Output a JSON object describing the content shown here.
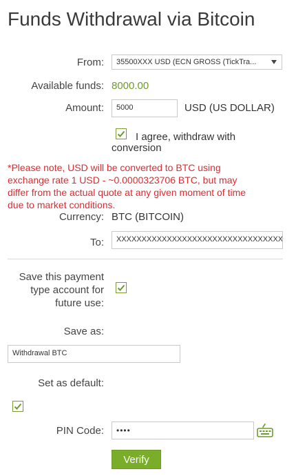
{
  "page": {
    "title": "Funds Withdrawal via Bitcoin"
  },
  "form": {
    "from_label": "From:",
    "from_value": "35500XXX USD (ECN GROSS (TickTra...",
    "available_label": "Available funds:",
    "available_value": "8000.00",
    "amount_label": "Amount:",
    "amount_value": "5000",
    "amount_currency": "USD (US DOLLAR)",
    "agree_line1": "I agree, withdraw with",
    "agree_line2": "conversion",
    "agree_checked": true,
    "note_lines": [
      "*Please note, USD will be converted to BTC using",
      "exchange rate 1 USD - ~0.0000323706 BTC, but may",
      "differ from the actual quote at any given moment of time",
      "due to market conditions."
    ],
    "currency_label": "Currency:",
    "currency_value": "BTC (BITCOIN)",
    "to_label": "To:",
    "to_value": "XXXXXXXXXXXXXXXXXXXXXXXXXXXXXXXXXX",
    "save_label_lines": [
      "Save this payment",
      "type account for",
      "future use:"
    ],
    "save_checked": true,
    "save_as_label": "Save as:",
    "save_as_value": "Withdrawal BTC",
    "default_label": "Set as default:",
    "default_checked": true,
    "pin_label": "PIN Code:",
    "pin_value": "••••",
    "verify_label": "Verify"
  },
  "icons": {
    "keyboard": "keyboard-icon",
    "dropdown": "chevron-down-icon",
    "check": "check-icon"
  },
  "colors": {
    "accent_green": "#6d9a2b",
    "button_green": "#7aae2a",
    "warning_red": "#e3292f"
  }
}
